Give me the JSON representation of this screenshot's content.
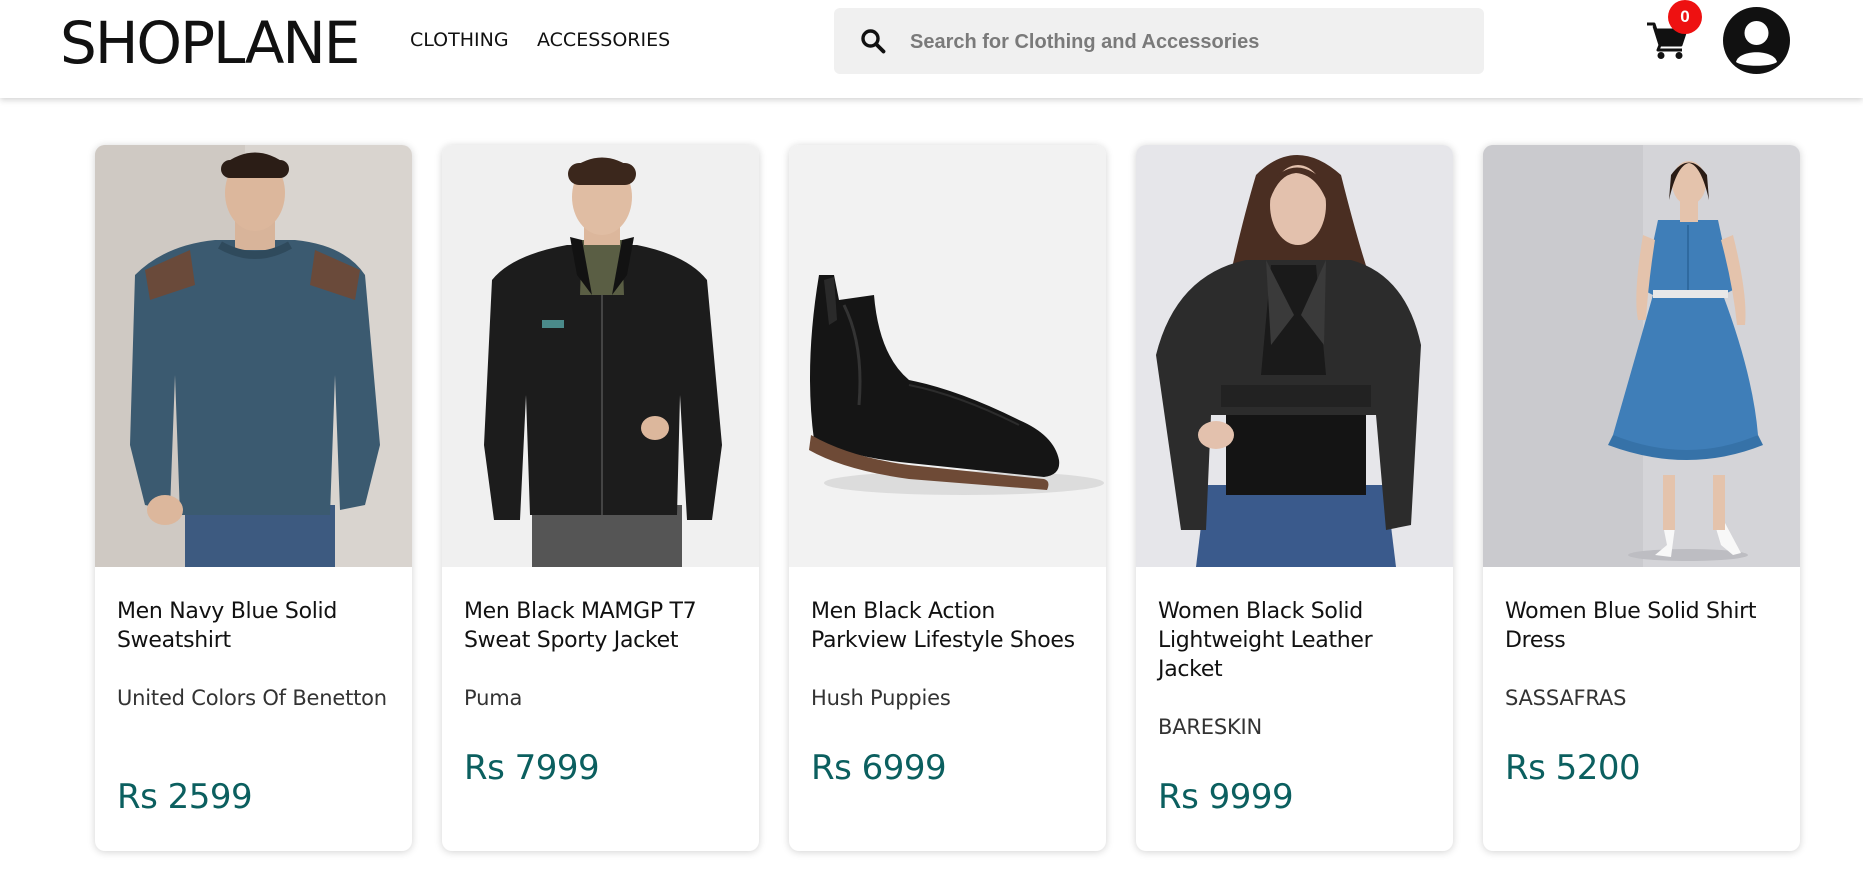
{
  "header": {
    "logo": "SHOPLANE",
    "nav": [
      "CLOTHING",
      "ACCESSORIES"
    ],
    "search_placeholder": "Search for Clothing and Accessories",
    "cart_count": "0",
    "icons": [
      "search-icon",
      "cart-icon",
      "user-avatar-icon"
    ],
    "colors": {
      "badge": "#ee1111"
    }
  },
  "products": [
    {
      "name": "Men Navy Blue Solid Sweatshirt",
      "brand": "United Colors Of Benetton",
      "price": "Rs 2599"
    },
    {
      "name": "Men Black MAMGP T7 Sweat Sporty Jacket",
      "brand": "Puma",
      "price": "Rs 7999"
    },
    {
      "name": "Men Black Action Parkview Lifestyle Shoes",
      "brand": "Hush Puppies",
      "price": "Rs 6999"
    },
    {
      "name": "Women Black Solid Lightweight Leather Jacket",
      "brand": "BARESKIN",
      "price": "Rs 9999"
    },
    {
      "name": "Women Blue Solid Shirt Dress",
      "brand": "SASSAFRAS",
      "price": "Rs 5200"
    }
  ],
  "colors": {
    "price": "#0b5f5f"
  }
}
